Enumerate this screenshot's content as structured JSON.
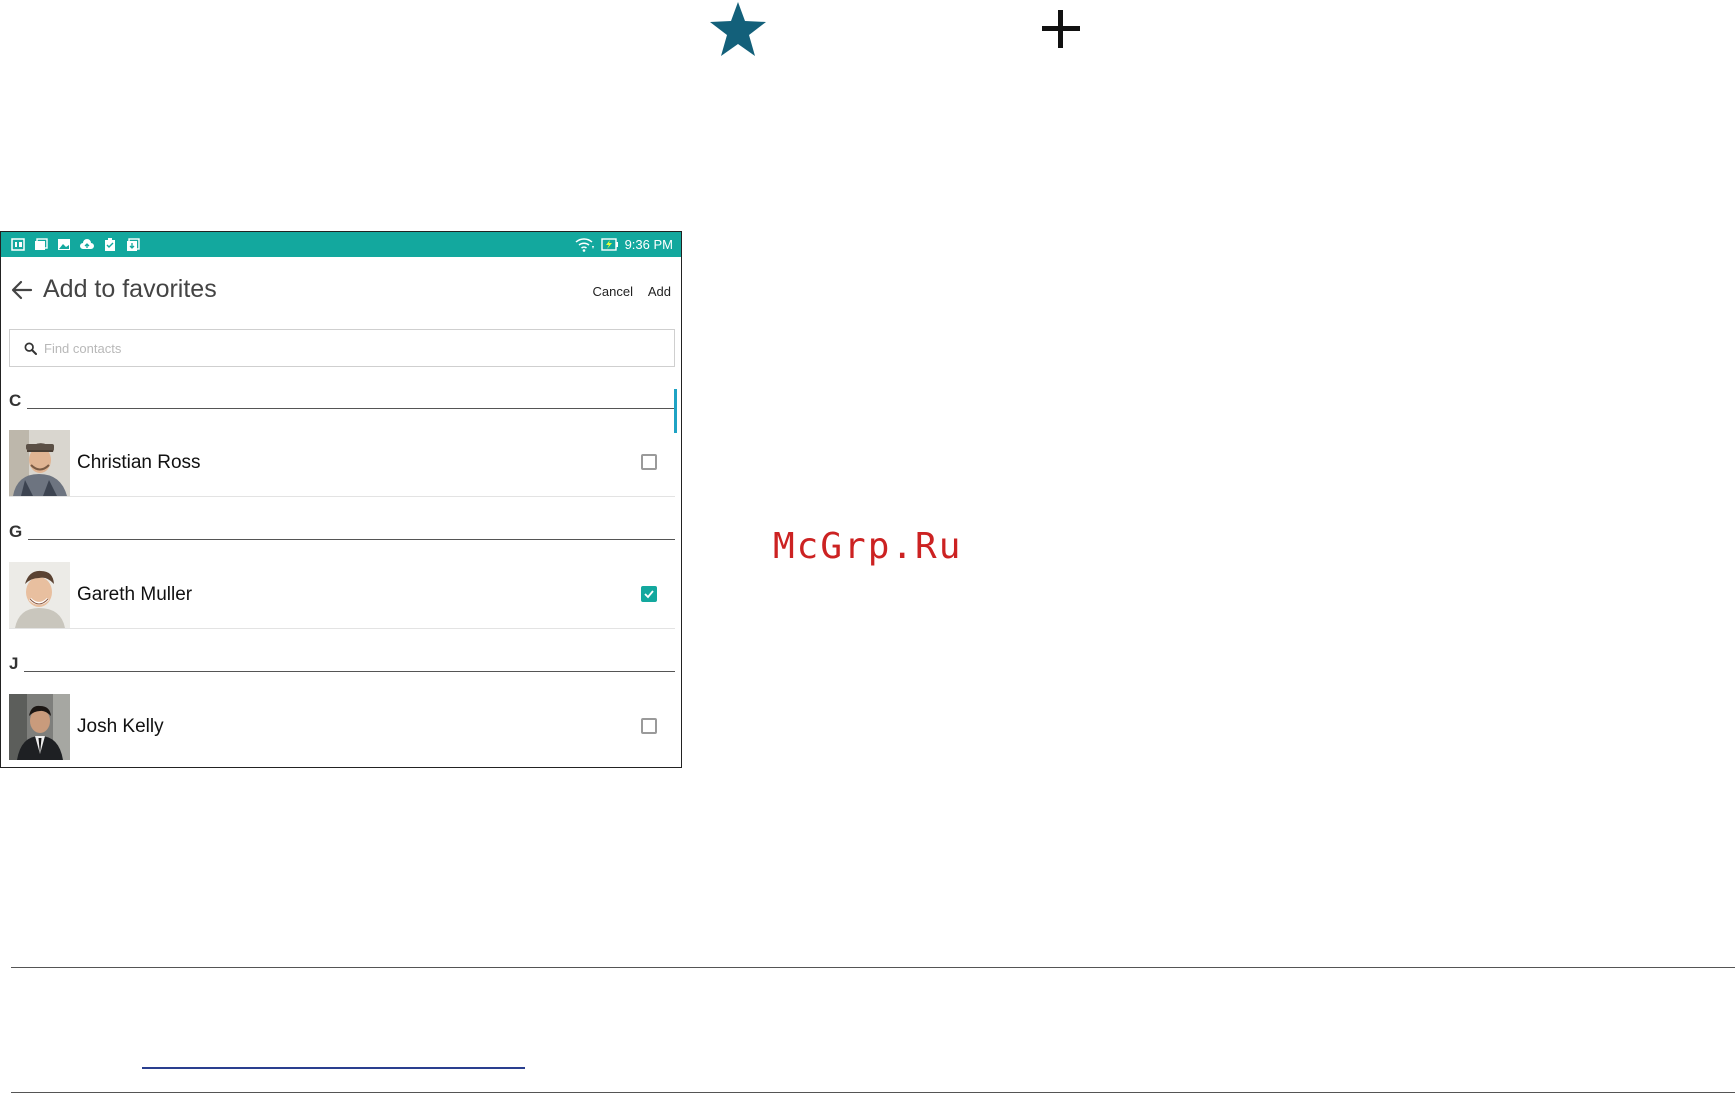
{
  "colors": {
    "accent": "#13a89e",
    "star": "#13607a",
    "watermark": "#cc2222",
    "link_rule": "#2a3f8f"
  },
  "page_icons": [
    "star-icon",
    "plus-icon"
  ],
  "status_bar": {
    "time": "9:36 PM",
    "left_icons": [
      "app-notification-icon",
      "gallery-icon",
      "image-icon",
      "cloud-upload-icon",
      "clipboard-check-icon",
      "download-icon"
    ],
    "right_icons": [
      "wifi-icon",
      "battery-charging-icon"
    ]
  },
  "app_bar": {
    "title": "Add to favorites",
    "cancel_label": "Cancel",
    "add_label": "Add"
  },
  "search": {
    "placeholder": "Find contacts",
    "value": ""
  },
  "sections": [
    {
      "letter": "C",
      "contacts": [
        {
          "name": "Christian Ross",
          "checked": false
        }
      ]
    },
    {
      "letter": "G",
      "contacts": [
        {
          "name": "Gareth Muller",
          "checked": true
        }
      ]
    },
    {
      "letter": "J",
      "contacts": [
        {
          "name": "Josh Kelly",
          "checked": false
        }
      ]
    }
  ],
  "watermark": "McGrp.Ru"
}
